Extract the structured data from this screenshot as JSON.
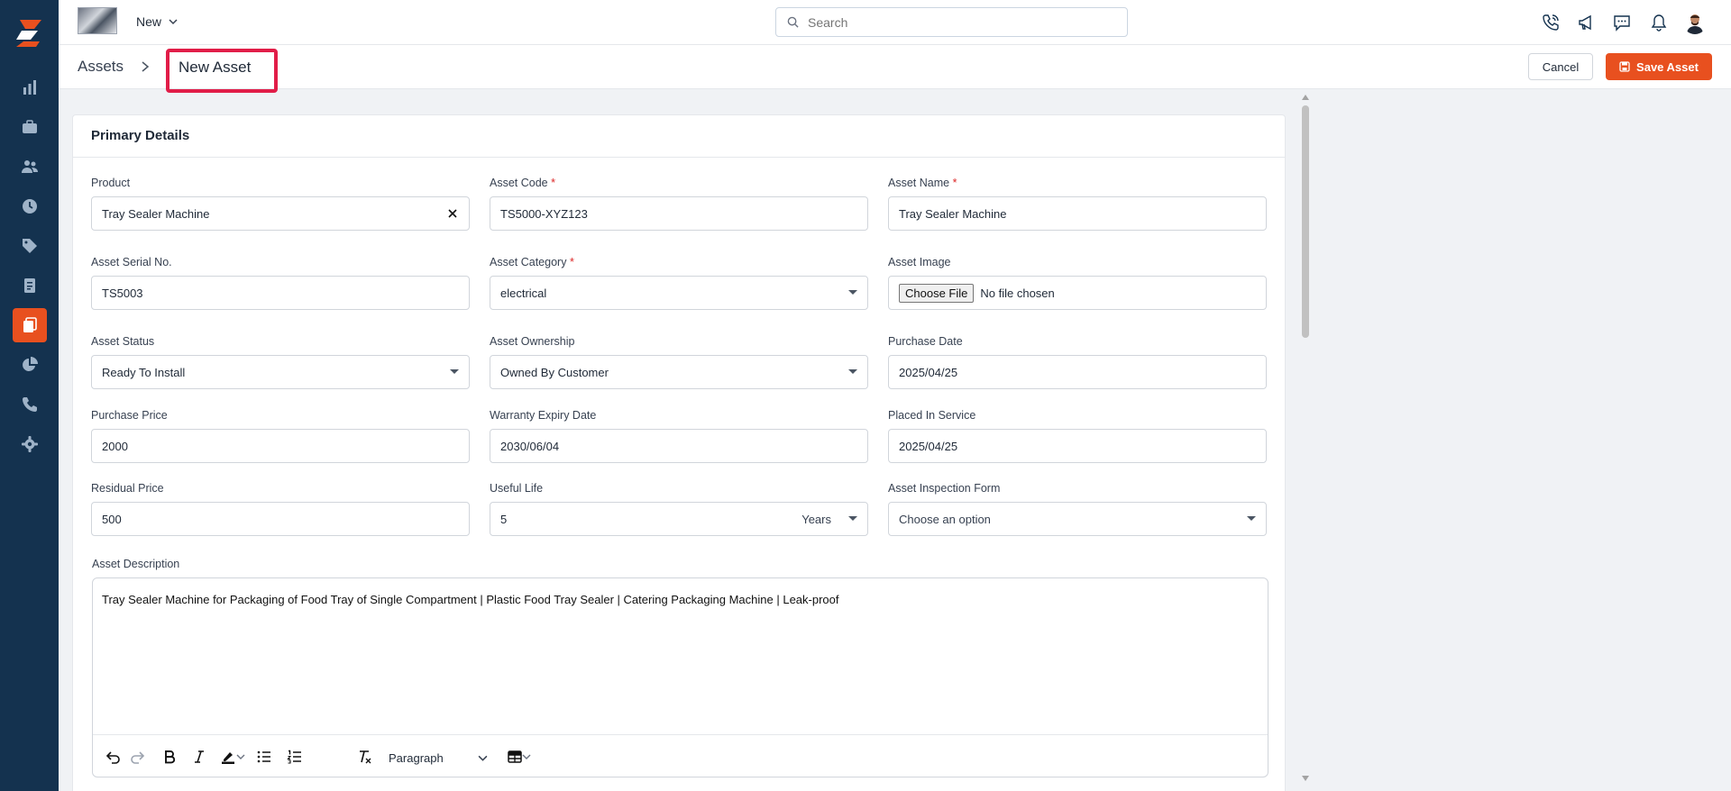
{
  "topbar": {
    "new_label": "New",
    "search_placeholder": "Search"
  },
  "breadcrumb": {
    "parent": "Assets",
    "current": "New Asset"
  },
  "actions": {
    "cancel": "Cancel",
    "save": "Save Asset"
  },
  "colors": {
    "sidebar": "#14324f",
    "accent": "#e8501f",
    "highlight_box": "#e11d48"
  },
  "sidebar": {
    "items": [
      "dashboard-icon",
      "briefcase-icon",
      "users-icon",
      "clock-icon",
      "tag-icon",
      "invoice-icon",
      "assets-icon",
      "reports-icon",
      "phone-icon",
      "settings-icon"
    ],
    "active": "assets-icon"
  },
  "section_title": "Primary Details",
  "fields": {
    "product": {
      "label": "Product",
      "value": "Tray Sealer Machine"
    },
    "asset_code": {
      "label": "Asset Code",
      "value": "TS5000-XYZ123"
    },
    "asset_name": {
      "label": "Asset Name",
      "value": "Tray Sealer Machine"
    },
    "serial_no": {
      "label": "Asset Serial No.",
      "value": "TS5003"
    },
    "category": {
      "label": "Asset Category",
      "value": "electrical"
    },
    "image": {
      "label": "Asset Image",
      "button": "Choose File",
      "status": "No file chosen"
    },
    "status": {
      "label": "Asset Status",
      "value": "Ready To Install"
    },
    "ownership": {
      "label": "Asset Ownership",
      "value": "Owned By Customer"
    },
    "purchase_date": {
      "label": "Purchase Date",
      "value": "2025/04/25"
    },
    "purchase_price": {
      "label": "Purchase Price",
      "value": "2000"
    },
    "warranty_expiry": {
      "label": "Warranty Expiry Date",
      "value": "2030/06/04"
    },
    "placed_in_service": {
      "label": "Placed In Service",
      "value": "2025/04/25"
    },
    "residual_price": {
      "label": "Residual Price",
      "value": "500"
    },
    "useful_life": {
      "label": "Useful Life",
      "value": "5",
      "unit": "Years"
    },
    "inspection_form": {
      "label": "Asset Inspection Form",
      "placeholder": "Choose an option"
    }
  },
  "required_marker": "*",
  "description": {
    "label": "Asset Description",
    "text": "Tray Sealer Machine for Packaging of Food Tray of Single Compartment | Plastic Food Tray Sealer | Catering Packaging Machine | Leak-proof",
    "block_format": "Paragraph"
  }
}
